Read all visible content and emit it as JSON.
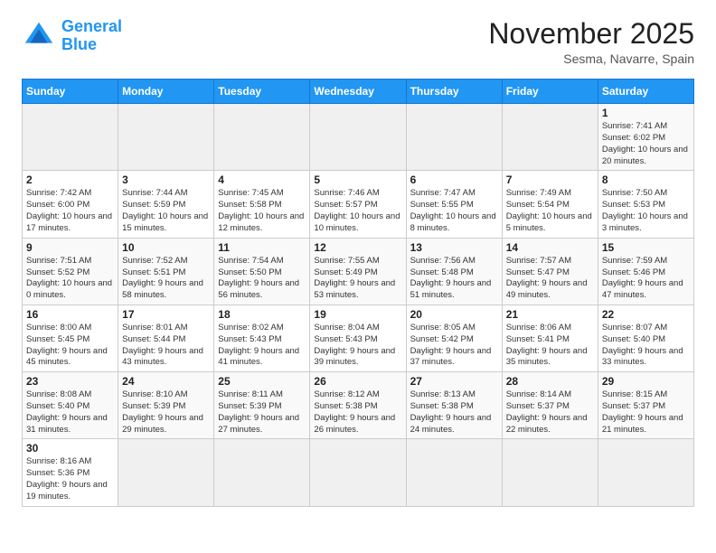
{
  "header": {
    "logo_general": "General",
    "logo_blue": "Blue",
    "month": "November 2025",
    "location": "Sesma, Navarre, Spain"
  },
  "weekdays": [
    "Sunday",
    "Monday",
    "Tuesday",
    "Wednesday",
    "Thursday",
    "Friday",
    "Saturday"
  ],
  "days": {
    "1": {
      "sunrise": "7:41 AM",
      "sunset": "6:02 PM",
      "daylight": "10 hours and 20 minutes."
    },
    "2": {
      "sunrise": "7:42 AM",
      "sunset": "6:00 PM",
      "daylight": "10 hours and 17 minutes."
    },
    "3": {
      "sunrise": "7:44 AM",
      "sunset": "5:59 PM",
      "daylight": "10 hours and 15 minutes."
    },
    "4": {
      "sunrise": "7:45 AM",
      "sunset": "5:58 PM",
      "daylight": "10 hours and 12 minutes."
    },
    "5": {
      "sunrise": "7:46 AM",
      "sunset": "5:57 PM",
      "daylight": "10 hours and 10 minutes."
    },
    "6": {
      "sunrise": "7:47 AM",
      "sunset": "5:55 PM",
      "daylight": "10 hours and 8 minutes."
    },
    "7": {
      "sunrise": "7:49 AM",
      "sunset": "5:54 PM",
      "daylight": "10 hours and 5 minutes."
    },
    "8": {
      "sunrise": "7:50 AM",
      "sunset": "5:53 PM",
      "daylight": "10 hours and 3 minutes."
    },
    "9": {
      "sunrise": "7:51 AM",
      "sunset": "5:52 PM",
      "daylight": "10 hours and 0 minutes."
    },
    "10": {
      "sunrise": "7:52 AM",
      "sunset": "5:51 PM",
      "daylight": "9 hours and 58 minutes."
    },
    "11": {
      "sunrise": "7:54 AM",
      "sunset": "5:50 PM",
      "daylight": "9 hours and 56 minutes."
    },
    "12": {
      "sunrise": "7:55 AM",
      "sunset": "5:49 PM",
      "daylight": "9 hours and 53 minutes."
    },
    "13": {
      "sunrise": "7:56 AM",
      "sunset": "5:48 PM",
      "daylight": "9 hours and 51 minutes."
    },
    "14": {
      "sunrise": "7:57 AM",
      "sunset": "5:47 PM",
      "daylight": "9 hours and 49 minutes."
    },
    "15": {
      "sunrise": "7:59 AM",
      "sunset": "5:46 PM",
      "daylight": "9 hours and 47 minutes."
    },
    "16": {
      "sunrise": "8:00 AM",
      "sunset": "5:45 PM",
      "daylight": "9 hours and 45 minutes."
    },
    "17": {
      "sunrise": "8:01 AM",
      "sunset": "5:44 PM",
      "daylight": "9 hours and 43 minutes."
    },
    "18": {
      "sunrise": "8:02 AM",
      "sunset": "5:43 PM",
      "daylight": "9 hours and 41 minutes."
    },
    "19": {
      "sunrise": "8:04 AM",
      "sunset": "5:43 PM",
      "daylight": "9 hours and 39 minutes."
    },
    "20": {
      "sunrise": "8:05 AM",
      "sunset": "5:42 PM",
      "daylight": "9 hours and 37 minutes."
    },
    "21": {
      "sunrise": "8:06 AM",
      "sunset": "5:41 PM",
      "daylight": "9 hours and 35 minutes."
    },
    "22": {
      "sunrise": "8:07 AM",
      "sunset": "5:40 PM",
      "daylight": "9 hours and 33 minutes."
    },
    "23": {
      "sunrise": "8:08 AM",
      "sunset": "5:40 PM",
      "daylight": "9 hours and 31 minutes."
    },
    "24": {
      "sunrise": "8:10 AM",
      "sunset": "5:39 PM",
      "daylight": "9 hours and 29 minutes."
    },
    "25": {
      "sunrise": "8:11 AM",
      "sunset": "5:39 PM",
      "daylight": "9 hours and 27 minutes."
    },
    "26": {
      "sunrise": "8:12 AM",
      "sunset": "5:38 PM",
      "daylight": "9 hours and 26 minutes."
    },
    "27": {
      "sunrise": "8:13 AM",
      "sunset": "5:38 PM",
      "daylight": "9 hours and 24 minutes."
    },
    "28": {
      "sunrise": "8:14 AM",
      "sunset": "5:37 PM",
      "daylight": "9 hours and 22 minutes."
    },
    "29": {
      "sunrise": "8:15 AM",
      "sunset": "5:37 PM",
      "daylight": "9 hours and 21 minutes."
    },
    "30": {
      "sunrise": "8:16 AM",
      "sunset": "5:36 PM",
      "daylight": "9 hours and 19 minutes."
    }
  }
}
